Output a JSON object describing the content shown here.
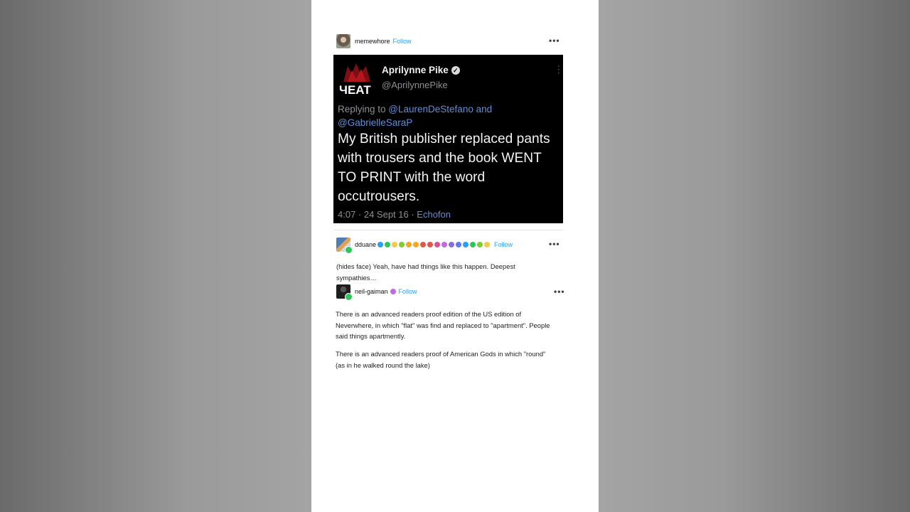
{
  "posts": [
    {
      "username": "memewhore",
      "follow": "Follow",
      "more": "•••"
    },
    {
      "username": "dduane",
      "follow": "Follow",
      "more": "•••",
      "body": "(hides face) Yeah, have had things like this happen. Deepest sympathies…"
    },
    {
      "username": "neil-gaiman",
      "follow": "Follow",
      "more": "•••",
      "paragraph1": "There is an advanced readers proof edition of the US edition of Neverwhere, in which \"flat\" was find and replaced  to \"apartment\". People said things apartmently.",
      "paragraph2": "There is an advanced readers proof of American Gods in which \"round\" (as in he walked round the lake)"
    }
  ],
  "tweet": {
    "avatar_text": "ЧEAT",
    "name": "Aprilynne Pike",
    "handle": "@AprilynnePike",
    "replying_prefix": "Replying to ",
    "replying_mentions": "@LaurenDeStefano and @GabrielleSaraP",
    "text": "My British publisher replaced pants with trousers and the book WENT TO PRINT with the word occutrousers.",
    "time": "4:07 · 24 Sept 16 · ",
    "source": "Echofon"
  },
  "colors": {
    "follow": "#2a9df4",
    "mention": "#5f8fd6",
    "tweet_bg": "#000000",
    "badges": [
      "#2a9df4",
      "#2ec65b",
      "#f2c94c",
      "#7bd02e",
      "#f5a623",
      "#f5a623",
      "#e2574c",
      "#e2574c",
      "#d94fa0",
      "#c06be0",
      "#8a6be0",
      "#5b7bf0",
      "#2a9df4",
      "#2ec65b",
      "#7bd02e",
      "#f2c94c"
    ]
  }
}
